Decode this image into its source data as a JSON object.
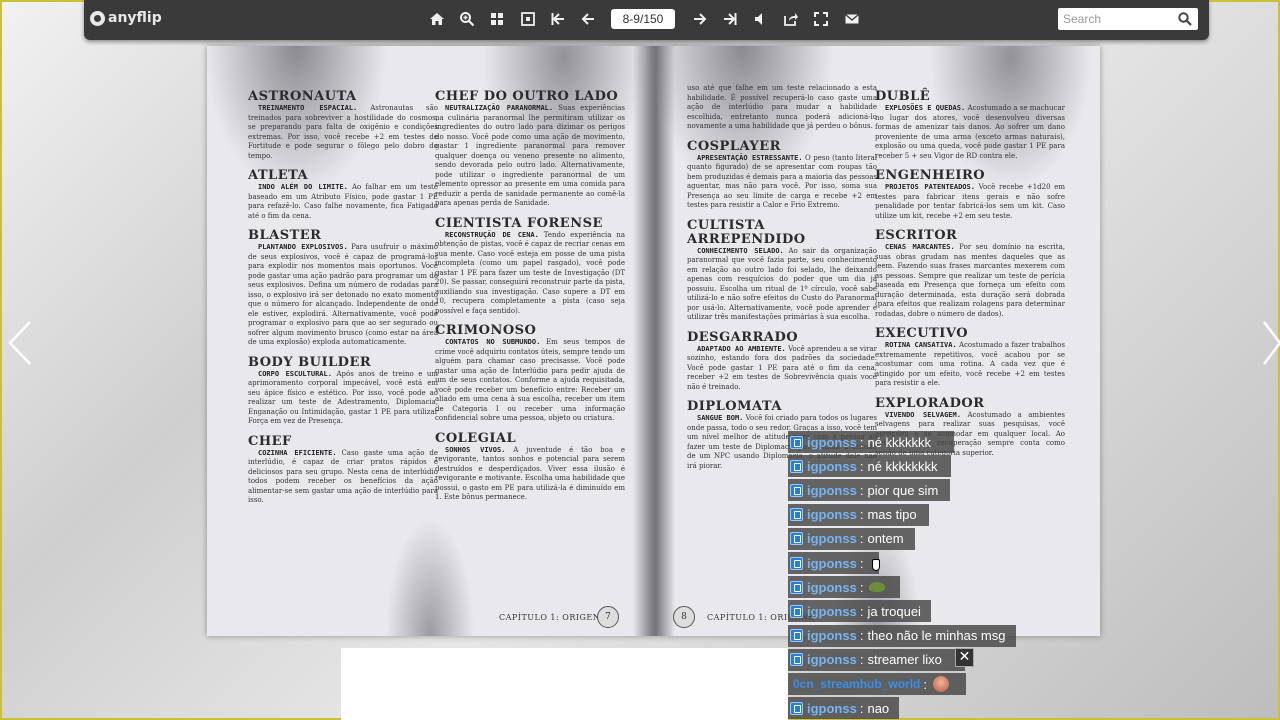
{
  "toolbar": {
    "logo_text": "anyflip",
    "page_indicator": "8-9/150",
    "search_placeholder": "Search",
    "icons": [
      "home-icon",
      "zoom-in-icon",
      "thumbnails-icon",
      "single-page-icon",
      "first-page-icon",
      "previous-page-icon",
      "next-page-icon",
      "last-page-icon",
      "sound-icon",
      "share-icon",
      "fullscreen-icon",
      "email-icon"
    ]
  },
  "book": {
    "left_page": {
      "col1": [
        {
          "title": "ASTRONAUTA",
          "sub": "TREINAMENTO ESPACIAL.",
          "text": "Astronautas são treinados para sobreviver a hostilidade do cosmos, se preparando para falta de oxigênio e condições extremas. Por isso, você recebe +2 em testes de Fortitude e pode segurar o fôlego pelo dobro do tempo."
        },
        {
          "title": "ATLETA",
          "sub": "INDO ALÉM DO LIMITE.",
          "text": "Ao falhar em um teste baseado em um Atributo Físico, pode gastar 1 PE para refazê-lo. Caso falhe novamente, fica Fatigado até o fim da cena."
        },
        {
          "title": "BLASTER",
          "sub": "PLANTANDO EXPLOSIVOS.",
          "text": "Para usufruir o máximo de seus explosivos, você é capaz de programá-los para explodir nos momentos mais oportunos. Você pode gastar uma ação padrão para programar um de seus explosivos. Defina um número de rodadas para isso, o explosivo irá ser detonado no exato momento que o número for alcançado. Independente de onde ele estiver, explodirá. Alternativamente, você pode programar o explosivo para que ao ser segurado ou sofrer algum movimento brusco (como estar na área de uma explosão) exploda automaticamente."
        },
        {
          "title": "BODY BUILDER",
          "sub": "CORPO ESCULTURAL.",
          "text": "Após anos de treino e um aprimoramento corporal impecável, você está em seu ápice físico e estético. Por isso, você pode ao realizar um teste de Adestramento, Diplomacia, Enganação ou Intimidação, gastar 1 PE para utilizar Força em vez de Presença."
        },
        {
          "title": "CHEF",
          "sub": "COZINHA EFICIENTE.",
          "text": "Caso gaste uma ação de interlúdio, é capaz de criar pratos rápidos e deliciosos para seu grupo. Nesta cena de interlúdio todos podem receber os benefícios da ação alimentar-se sem gastar uma ação de interlúdio para isso."
        }
      ],
      "col2": [
        {
          "title": "CHEF DO OUTRO LADO",
          "sub": "NEUTRALIZAÇÃO PARANORMAL.",
          "text": "Suas experiências na culinária paranormal lhe permitiram utilizar os ingredientes do outro lado para dizimar os perigos do nosso. Você pode como uma ação de movimento, gastar 1 ingrediente paranormal para remover qualquer doença ou veneno presente no alimento, sendo devorada pelo outro lado. Alternativamente, pode utilizar o ingrediente paranormal de um elemento opressor ao presente em uma comida para reduzir a perda de sanidade permanente ao comê-la para apenas perda de Sanidade."
        },
        {
          "title": "CIENTISTA FORENSE",
          "sub": "RECONSTRUÇÃO DE CENA.",
          "text": "Tendo experiência na obtenção de pistas, você é capaz de recriar cenas em sua mente. Caso você esteja em posse de uma pista incompleta (como um papel rasgado), você pode gastar 1 PE para fazer um teste de Investigação (DT 20). Se passar, conseguirá reconstruir parte da pista, auxiliando sua investigação. Caso supere a DT em 10, recupera completamente a pista (caso seja possível e faça sentido)."
        },
        {
          "title": "CRIMONOSO",
          "sub": "CONTATOS NO SUBMUNDO.",
          "text": "Em seus tempos de crime você adquiriu contatos úteis, sempre tendo um alguém para chamar caso precisasse. Você pode gastar uma ação de Interlúdio para pedir ajuda de um de seus contatos. Conforme a ajuda requisitada, você pode receber um benefício entre: Receber um aliado em uma cena à sua escolha, receber um item de Categoria I ou receber uma informação confidencial sobre uma pessoa, objeto ou criatura."
        },
        {
          "title": "COLEGIAL",
          "sub": "SONHOS VIVOS.",
          "text": "A juventude é tão boa e revigorante, tantos sonhos e potencial para serem destruídos e desperdiçados. Viver essa ilusão é revigorante e motivante. Escolha uma habilidade que possui, o gasto em PE para utilizá-la é diminuído em 1. Este bônus permanece."
        }
      ],
      "footer": "CAPÍTULO 1: ORIGENS",
      "page_number": "7"
    },
    "right_page": {
      "col1": [
        {
          "title": "",
          "sub": "",
          "text": "uso até que falhe em um teste relacionado a esta habilidade. É possível recuperá-lo caso gaste uma ação de interlúdio para mudar a habilidade escolhida, entretanto nunca poderá adicioná-lo novamente a uma habilidade que já perdeu o bônus."
        },
        {
          "title": "COSPLAYER",
          "sub": "APRESENTAÇÃO ESTRESSANTE.",
          "text": "O peso (tanto literal quanto figurado) de se apresentar com roupas tão bem produzidas é demais para a maioria das pessoas aguentar, mas não para você. Por isso, soma sua Presença ao seu limite de carga e recebe +2 em testes para resistir a Calor e Frio Extremo."
        },
        {
          "title": "CULTISTA ARREPENDIDO",
          "sub": "CONHECIMENTO SELADO.",
          "text": "Ao sair da organização paranormal que você fazia parte, seu conhecimento em relação ao outro lado foi selado, lhe deixando apenas com resquícios do poder que um dia já possuiu. Escolha um ritual de 1º círculo, você sabe utilizá-lo e não sofre efeitos do Custo do Paranormal por usá-lo. Alternativamente, você pode aprender e utilizar três manifestações primárias à sua escolha."
        },
        {
          "title": "DESGARRADO",
          "sub": "ADAPTADO AO AMBIENTE.",
          "text": "Você aprendeu a se virar sozinho, estando fora dos padrões da sociedade. Você pode gastar 1 PE para até o fim da cena, receber +2 em testes de Sobrevivência quais você não é treinado."
        },
        {
          "title": "DIPLOMATA",
          "sub": "SANGUE BOM.",
          "text": "Você foi criado para todos os lugares onde passa, todo o seu redor. Graças a isso, você tem um nível melhor de atitude para com a pessoa ao fazer um teste de Diplomacia para mudar a atitude de um NPC usando Diplomacia, o atitude dele não irá piorar."
        }
      ],
      "col2": [
        {
          "title": "DUBLÊ",
          "sub": "EXPLOSÕES E QUEDAS.",
          "text": "Acostumado a se machucar no lugar dos atores, você desenvolveu diversas formas de amenizar tais danos. Ao sofrer um dano proveniente de uma arma (exceto armas naturais), explosão ou uma queda, você pode gastar 1 PE para receber 5 + seu Vigor de RD contra ele."
        },
        {
          "title": "ENGENHEIRO",
          "sub": "PROJETOS PATENTEADOS.",
          "text": "Você recebe +1d20 em testes para fabricar itens gerais e não sofre penalidade por tentar fabricá-los sem um kit. Caso utilize um kit, recebe +2 em seu teste."
        },
        {
          "title": "ESCRITOR",
          "sub": "CENAS MARCANTES.",
          "text": "Por seu domínio na escrita, suas obras grudam nas mentes daqueles que as leem. Fazendo suas frases marcantes mexerem com as pessoas. Sempre que realizar um teste de perícia baseada em Presença que forneça um efeito com duração determinada, esta duração será dobrada (para efeitos que realizam rolagens para determinar rodadas, dobre o número de dados)."
        },
        {
          "title": "EXECUTIVO",
          "sub": "ROTINA CANSATIVA.",
          "text": "Acostumado a fazer trabalhos extremamente repetitivos, você acabou por se acostumar com uma rotina. A cada vez que é atingido por um efeito, você recebe +2 em testes para resistir a ele."
        },
        {
          "title": "EXPLORADOR",
          "sub": "VIVENDO SELVAGEM.",
          "text": "Acostumado a ambientes selvagens para realizar suas pesquisas, você aprendeu a se acomodar em qualquer local. Ao descansar, sua recuperação sempre conta como sendo de uma categoria superior."
        }
      ],
      "footer": "CAPÍTULO 1: ORIGENS",
      "page_number": "8"
    }
  },
  "chat": {
    "messages": [
      {
        "user": "igponss",
        "sep": ":",
        "text": "né kkkkkkk",
        "emote": ""
      },
      {
        "user": "igponss",
        "sep": ":",
        "text": "né kkkkkkkk",
        "emote": ""
      },
      {
        "user": "igponss",
        "sep": ":",
        "text": "pior que sim",
        "emote": ""
      },
      {
        "user": "igponss",
        "sep": ":",
        "text": "mas tipo",
        "emote": ""
      },
      {
        "user": "igponss",
        "sep": ":",
        "text": "ontem",
        "emote": ""
      },
      {
        "user": "igponss",
        "sep": ":",
        "text": "",
        "emote": ""
      },
      {
        "user": "igponss",
        "sep": ":",
        "text": "",
        "emote": "frog-emote"
      },
      {
        "user": "igponss",
        "sep": ":",
        "text": "ja troquei",
        "emote": ""
      },
      {
        "user": "igponss",
        "sep": ":",
        "text": "theo não le minhas msg",
        "emote": ""
      },
      {
        "user": "igponss",
        "sep": ":",
        "text": "streamer lixo",
        "emote": ""
      },
      {
        "user": "0cn_streamhub_world",
        "sep": ":",
        "text": "",
        "emote": "face-emote"
      },
      {
        "user": "igponss",
        "sep": ":",
        "text": "nao",
        "emote": ""
      }
    ],
    "close_label": "✕"
  },
  "colors": {
    "toolbar_bg": "#3a3a3a",
    "chat_user": "#7ab4f0",
    "chat_row_bg": "#464646"
  }
}
